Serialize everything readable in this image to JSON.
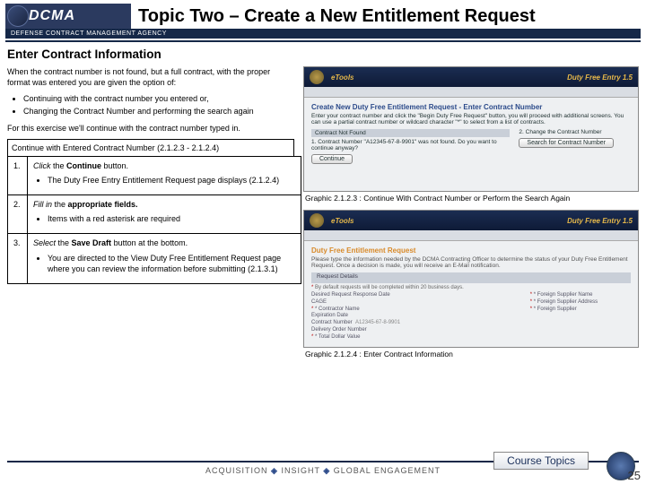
{
  "header": {
    "logo_text": "DCMA",
    "agency": "DEFENSE CONTRACT MANAGEMENT AGENCY",
    "title": "Topic Two – Create a New Entitlement Request"
  },
  "subhead": "Enter Contract Information",
  "intro": {
    "p1": "When the contract number is not found, but a full contract, with the proper format was entered you are given the option of:",
    "bullets": [
      "Continuing with the contract number you entered or,",
      "Changing the Contract Number and performing the search again"
    ],
    "p2": "For this exercise we'll continue with the contract number typed in."
  },
  "steps_header": "Continue with Entered Contract Number (2.1.2.3 - 2.1.2.4)",
  "steps": [
    {
      "n": "1.",
      "text_a": "Click",
      "text_b": " the ",
      "bold": "Continue",
      "text_c": " button.",
      "sub": [
        "The Duty Free Entry Entitlement Request page displays (2.1.2.4)"
      ]
    },
    {
      "n": "2.",
      "text_a": "Fill in",
      "text_b": " the ",
      "bold": "appropriate fields.",
      "text_c": "",
      "sub": [
        "Items with a red asterisk are required"
      ]
    },
    {
      "n": "3.",
      "text_a": "Select",
      "text_b": " the ",
      "bold": "Save Draft",
      "text_c": " button at the bottom.",
      "sub": [
        "You are directed to the View Duty Free Entitlement Request page where you can review the information before submitting (2.1.3.1)"
      ]
    }
  ],
  "shot1": {
    "brand": "eTools",
    "product": "Duty Free Entry 1.5",
    "heading": "Create New Duty Free Entitlement Request - Enter Contract Number",
    "desc": "Enter your contract number and click the \"Begin Duty Free Request\" button, you will proceed with additional screens. You can use a partial contract number or wildcard character \"*\" to select from a list of contracts.",
    "left_head": "Contract Not Found",
    "left_line": "1. Contract Number \"A12345-67-8-9901\" was not found. Do you want to continue anyway?",
    "btn1": "Continue",
    "right_head": "2. Change the Contract Number",
    "btn2": "Search for Contract Number",
    "caption": "Graphic 2.1.2.3 : Continue With Contract Number or Perform the Search Again"
  },
  "shot2": {
    "brand": "eTools",
    "product": "Duty Free Entry 1.5",
    "heading": "Duty Free Entitlement Request",
    "desc": "Please type the information needed by the DCMA Contracting Officer to determine the status of your Duty Free Entitlement Request. Once a decision is made, you will receive an E-Mail notification.",
    "section": "Request Details",
    "note": "By default requests will be completed within 20 business days.",
    "fields_left": [
      "Desired Request Response Date",
      "CAGE",
      "* Contractor Name",
      "Expiration Date",
      "Contract Number",
      "Delivery Order Number",
      "* Total Dollar Value"
    ],
    "contract_val": "A12345-67-8-9901",
    "fields_right": [
      "* Foreign Supplier Name",
      "* Foreign Supplier Address",
      "* Foreign Supplier"
    ],
    "caption": "Graphic 2.1.2.4 : Enter Contract Information"
  },
  "footer": {
    "tag_a": "ACQUISITION",
    "tag_mid": "INSIGHT",
    "tag_b": "GLOBAL ENGAGEMENT",
    "course_btn": "Course Topics",
    "page": "25"
  }
}
